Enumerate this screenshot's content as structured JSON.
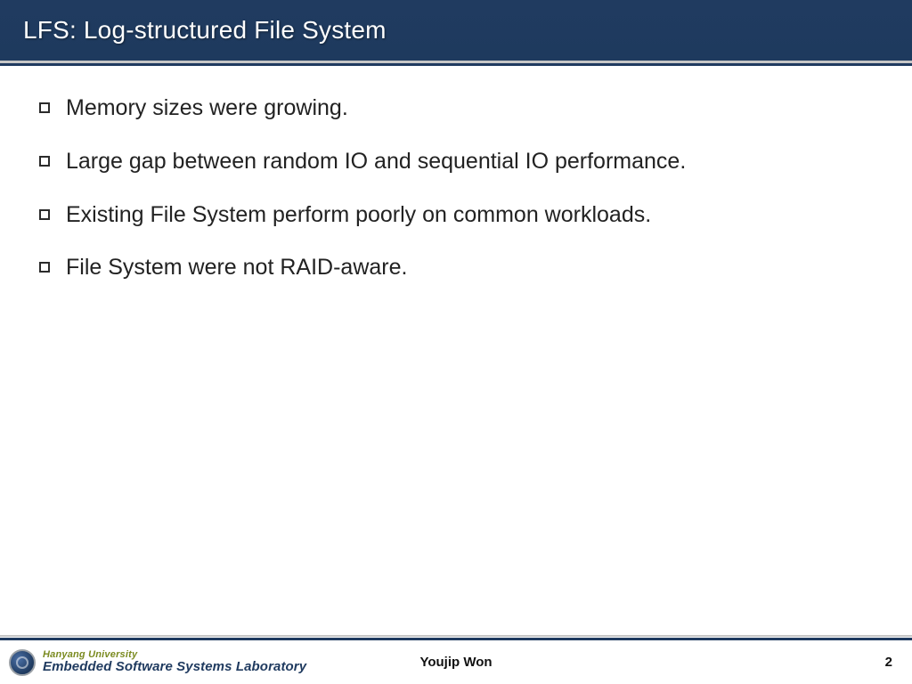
{
  "title": "LFS: Log-structured File System",
  "bullets": [
    "Memory sizes were growing.",
    "Large gap between random IO and sequential IO performance.",
    "Existing File System perform poorly on common workloads.",
    "File System were not RAID-aware."
  ],
  "footer": {
    "university": "Hanyang University",
    "lab": "Embedded Software Systems Laboratory",
    "author": "Youjip Won",
    "page": "2"
  }
}
